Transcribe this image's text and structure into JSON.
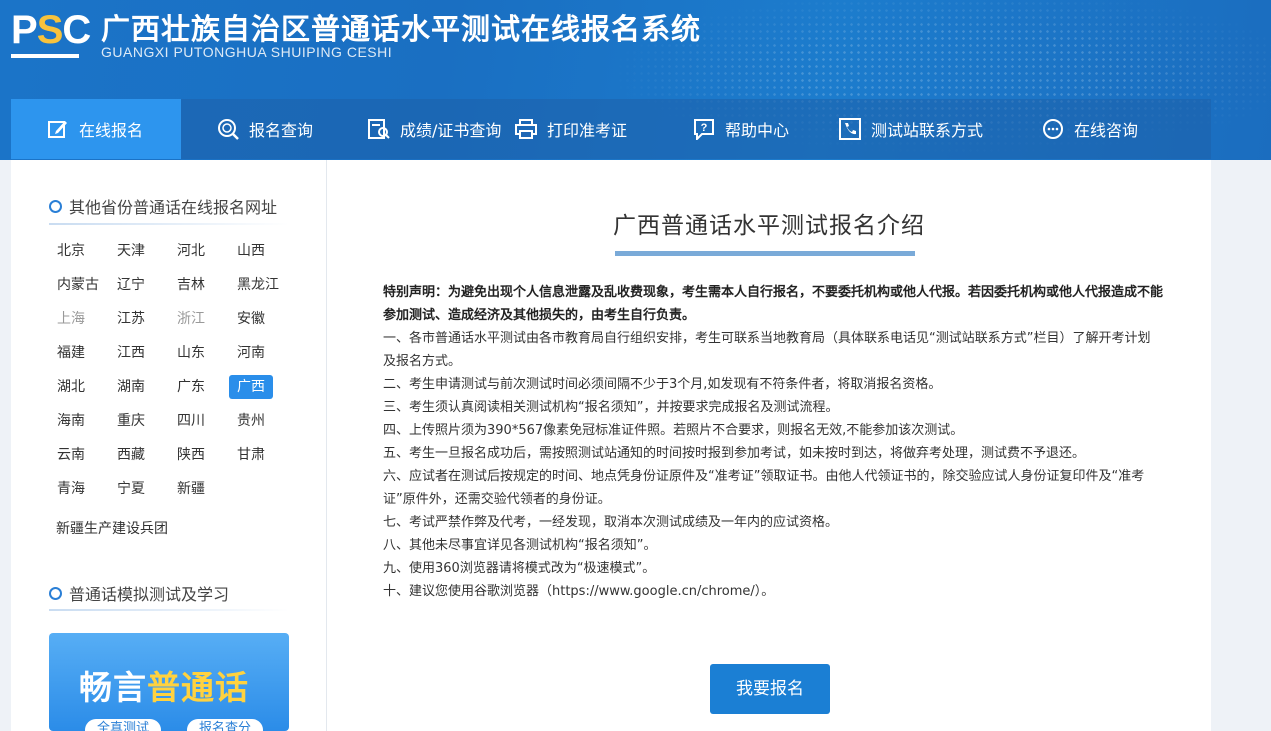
{
  "header": {
    "logo_text_p": "P",
    "logo_text_s": "S",
    "logo_text_c": "C",
    "title_cn": "广西壮族自治区普通话水平测试在线报名系统",
    "title_en": "GUANGXI PUTONGHUA SHUIPING CESHI"
  },
  "nav": {
    "items": [
      {
        "label": "在线报名",
        "icon": "edit-icon"
      },
      {
        "label": "报名查询",
        "icon": "search-icon"
      },
      {
        "label": "成绩/证书查询",
        "icon": "certificate-search-icon"
      },
      {
        "label": "打印准考证",
        "icon": "printer-icon"
      },
      {
        "label": "帮助中心",
        "icon": "help-icon"
      },
      {
        "label": "测试站联系方式",
        "icon": "phone-icon"
      },
      {
        "label": "在线咨询",
        "icon": "chat-icon"
      }
    ]
  },
  "sidebar": {
    "section1_title": "其他省份普通话在线报名网址",
    "provinces": [
      "北京",
      "天津",
      "河北",
      "山西",
      "内蒙古",
      "辽宁",
      "吉林",
      "黑龙江",
      "上海",
      "江苏",
      "浙江",
      "安徽",
      "福建",
      "江西",
      "山东",
      "河南",
      "湖北",
      "湖南",
      "广东",
      "广西",
      "海南",
      "重庆",
      "四川",
      "贵州",
      "云南",
      "西藏",
      "陕西",
      "甘肃",
      "青海",
      "宁夏",
      "新疆"
    ],
    "bingtuan": "新疆生产建设兵团",
    "section2_title": "普通话模拟测试及学习",
    "banner_prefix": "畅言",
    "banner_highlight": "普通话",
    "banner_pill1": "全真测试",
    "banner_pill2": "报名查分"
  },
  "main": {
    "title": "广西普通话水平测试报名介绍",
    "notice_bold": "特别声明：为避免出现个人信息泄露及乱收费现象，考生需本人自行报名，不要委托机构或他人代报。若因委托机构或他人代报造成不能参加测试、造成经济及其他损失的，由考生自行负责。",
    "items": [
      "一、各市普通话水平测试由各市教育局自行组织安排，考生可联系当地教育局（具体联系电话见“测试站联系方式”栏目）了解开考计划及报名方式。",
      "二、考生申请测试与前次测试时间必须间隔不少于3个月,如发现有不符条件者，将取消报名资格。",
      "三、考生须认真阅读相关测试机构“报名须知”，并按要求完成报名及测试流程。",
      "四、上传照片须为390*567像素免冠标准证件照。若照片不合要求，则报名无效,不能参加该次测试。",
      "五、考生一旦报名成功后，需按照测试站通知的时间按时报到参加考试，如未按时到达，将做弃考处理，测试费不予退还。",
      "六、应试者在测试后按规定的时间、地点凭身份证原件及“准考证”领取证书。由他人代领证书的，除交验应试人身份证复印件及“准考证”原件外，还需交验代领者的身份证。",
      "七、考试严禁作弊及代考，一经发现，取消本次测试成绩及一年内的应试资格。",
      "八、其他未尽事宜详见各测试机构“报名须知”。",
      "九、使用360浏览器请将模式改为“极速模式”。",
      "十、建议您使用谷歌浏览器（https://www.google.cn/chrome/）。"
    ],
    "enroll_button": "我要报名"
  }
}
